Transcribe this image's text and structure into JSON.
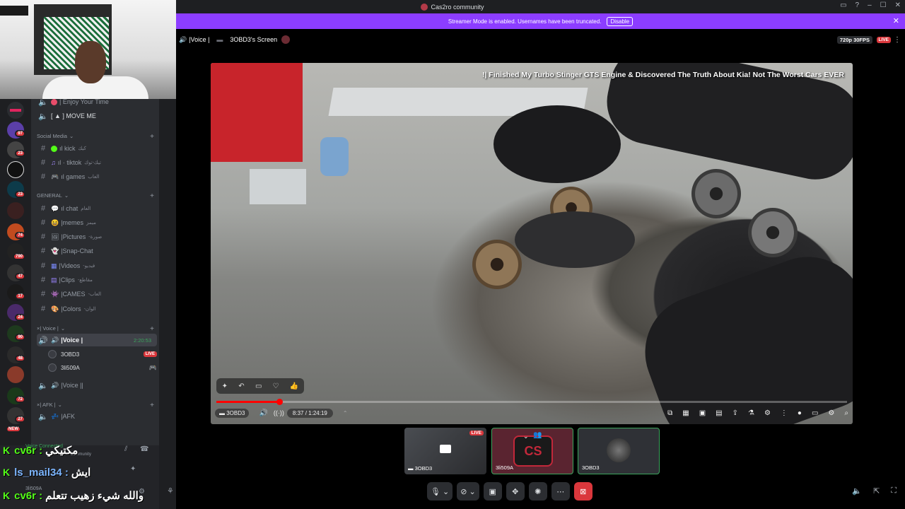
{
  "titlebar": {
    "title": "Cas2ro community"
  },
  "banner": {
    "text": "Streamer Mode is enabled. Usernames have been truncated.",
    "disable": "Disable"
  },
  "stage": {
    "channel": "|Voice |",
    "screen": "3OBD3's Screen",
    "quality": "720p 30FPS",
    "live": "LIVE"
  },
  "video": {
    "title": "!| Finished My Turbo Stinger GTS Engine & Discovered The Truth About Kia! Not The Worst Cars EVER",
    "chip": "3OBD3",
    "time": "8:37 / 1:24:19",
    "progress_percent": 10
  },
  "channels": {
    "top": [
      {
        "name": "| Enjoy Your Time",
        "color": "#e84d6a",
        "type": "voice"
      },
      {
        "name": "[ ▲ ] MOVE ME",
        "color": "#ffffff",
        "type": "voice"
      }
    ],
    "cat_social": "Social Media",
    "social": [
      {
        "name": "ıl kick",
        "ar": "كيك"
      },
      {
        "name": "ıl · tiktok",
        "ar": "تيك-توك"
      },
      {
        "name": "ıl games",
        "ar": "العاب"
      }
    ],
    "cat_general": "GENERAL",
    "general": [
      {
        "name": "ıl chat",
        "ar": "العام"
      },
      {
        "name": "|memes",
        "ar": "ميمز"
      },
      {
        "name": "|Pictures",
        "ar": "-صورة"
      },
      {
        "name": "|Snap-Chat",
        "ar": ""
      },
      {
        "name": "|Videos",
        "ar": "-فيديو"
      },
      {
        "name": "|Clips",
        "ar": "-مقاطع"
      },
      {
        "name": "|CAMES",
        "ar": "-العاب"
      },
      {
        "name": "|Colors",
        "ar": "-الوان"
      }
    ],
    "cat_voice": "| Voice |",
    "voice_active": "|Voice |",
    "voice_timer": "2:20:53",
    "voice_users": [
      {
        "name": "3OBD3",
        "live": "LIVE"
      },
      {
        "name": "3li509A",
        "live": ""
      }
    ],
    "voice_second": "|Voice ||",
    "cat_afk": "| AFK |",
    "afk": "|AFK"
  },
  "rail_badges": [
    "97",
    "23",
    "23",
    "74",
    "790",
    "47",
    "17",
    "24",
    "90",
    "48",
    "72",
    "27",
    "NEW"
  ],
  "panel": {
    "status": "Voice Connected",
    "server": "community",
    "user": "3li509A"
  },
  "kick_chat": [
    {
      "name": "cv6r :",
      "msg": "مكتيكي"
    },
    {
      "name": "ls_mail34 :",
      "msg": "ايش"
    },
    {
      "name": "cv6r :",
      "msg": "والله شيء زهيب تتعلم"
    }
  ],
  "tiles": [
    {
      "name": "3OBD3",
      "live": "LIVE"
    },
    {
      "name": "3li509A",
      "live": ""
    },
    {
      "name": "3OBD3",
      "live": ""
    }
  ]
}
